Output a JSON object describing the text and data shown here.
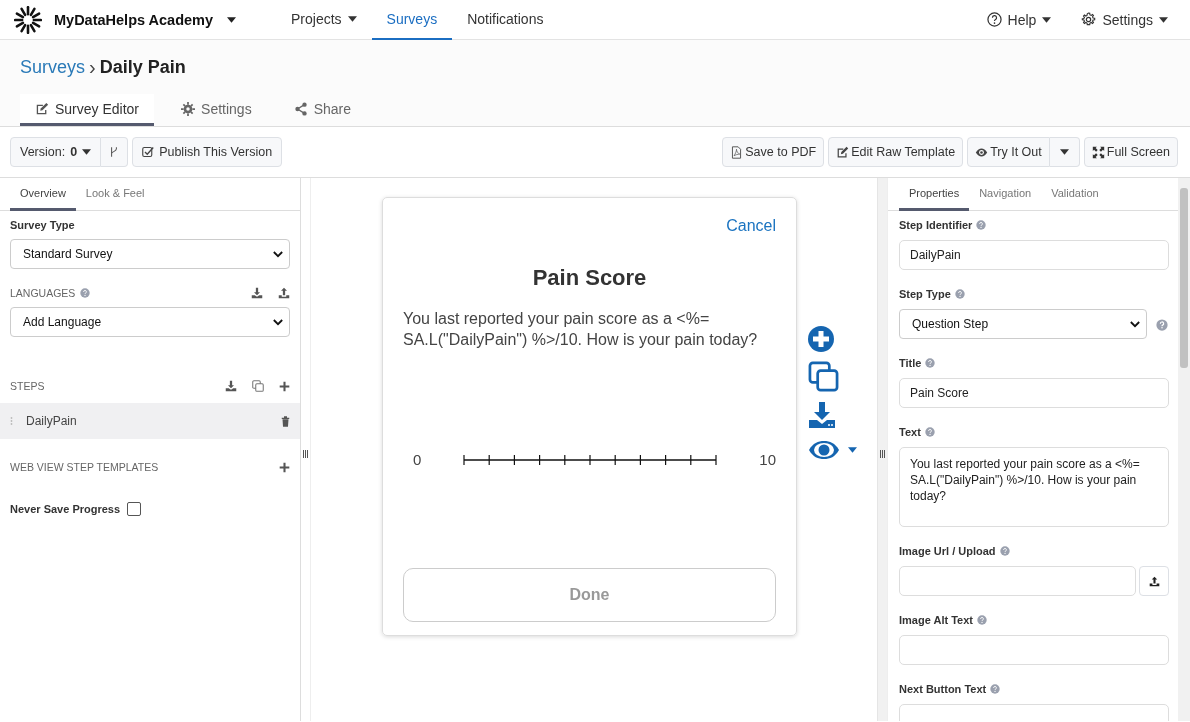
{
  "app": {
    "name": "MyDataHelps Academy"
  },
  "nav": [
    {
      "label": "Projects",
      "dropdown": true,
      "selected": false
    },
    {
      "label": "Surveys",
      "dropdown": false,
      "selected": true
    },
    {
      "label": "Notifications",
      "dropdown": false,
      "selected": false
    }
  ],
  "nav_right": [
    {
      "label": "Help"
    },
    {
      "label": "Settings"
    }
  ],
  "breadcrumb": {
    "parent": "Surveys",
    "separator": "›",
    "current": "Daily Pain"
  },
  "page_tabs": [
    {
      "label": "Survey Editor",
      "selected": true
    },
    {
      "label": "Settings",
      "selected": false
    },
    {
      "label": "Share",
      "selected": false
    }
  ],
  "toolbar": {
    "version_label": "Version:",
    "version": "0",
    "publish": "Publish This Version",
    "buttons": [
      {
        "label": "Save to PDF"
      },
      {
        "label": "Edit Raw Template"
      },
      {
        "label": "Try It Out",
        "split": true
      },
      {
        "label": "Full Screen"
      }
    ]
  },
  "left_panel": {
    "tabs": [
      {
        "label": "Overview",
        "selected": true
      },
      {
        "label": "Look & Feel",
        "selected": false
      }
    ],
    "survey_type_label": "Survey Type",
    "survey_type": "Standard Survey",
    "languages_label": "LANGUAGES",
    "language_select": "Add Language",
    "steps_label": "STEPS",
    "steps": [
      {
        "name": "DailyPain",
        "selected": true
      }
    ],
    "web_view_label": "WEB VIEW STEP TEMPLATES",
    "never_save": {
      "label": "Never Save Progress",
      "checked": false
    }
  },
  "preview": {
    "cancel": "Cancel",
    "title": "Pain Score",
    "text": "You last reported your pain score as a <%= SA.L(\"DailyPain\") %>/10. How is your pain today?",
    "scale_min": "0",
    "scale_max": "10",
    "done": "Done"
  },
  "right_panel": {
    "tabs": [
      {
        "label": "Properties",
        "selected": true
      },
      {
        "label": "Navigation",
        "selected": false
      },
      {
        "label": "Validation",
        "selected": false
      }
    ],
    "fields": [
      {
        "label": "Step Identifier",
        "kind": "input",
        "value": "DailyPain"
      },
      {
        "label": "Step Type",
        "kind": "select",
        "value": "Question Step"
      },
      {
        "label": "Title",
        "kind": "input",
        "value": "Pain Score"
      },
      {
        "label": "Text",
        "kind": "textarea",
        "value": "You last reported your pain score as a <%= SA.L(\"DailyPain\") %>/10. How is your pain today?"
      },
      {
        "label": "Image Url / Upload",
        "kind": "upload"
      },
      {
        "label": "Image Alt Text",
        "kind": "input"
      },
      {
        "label": "Next Button Text",
        "kind": "input"
      }
    ]
  }
}
